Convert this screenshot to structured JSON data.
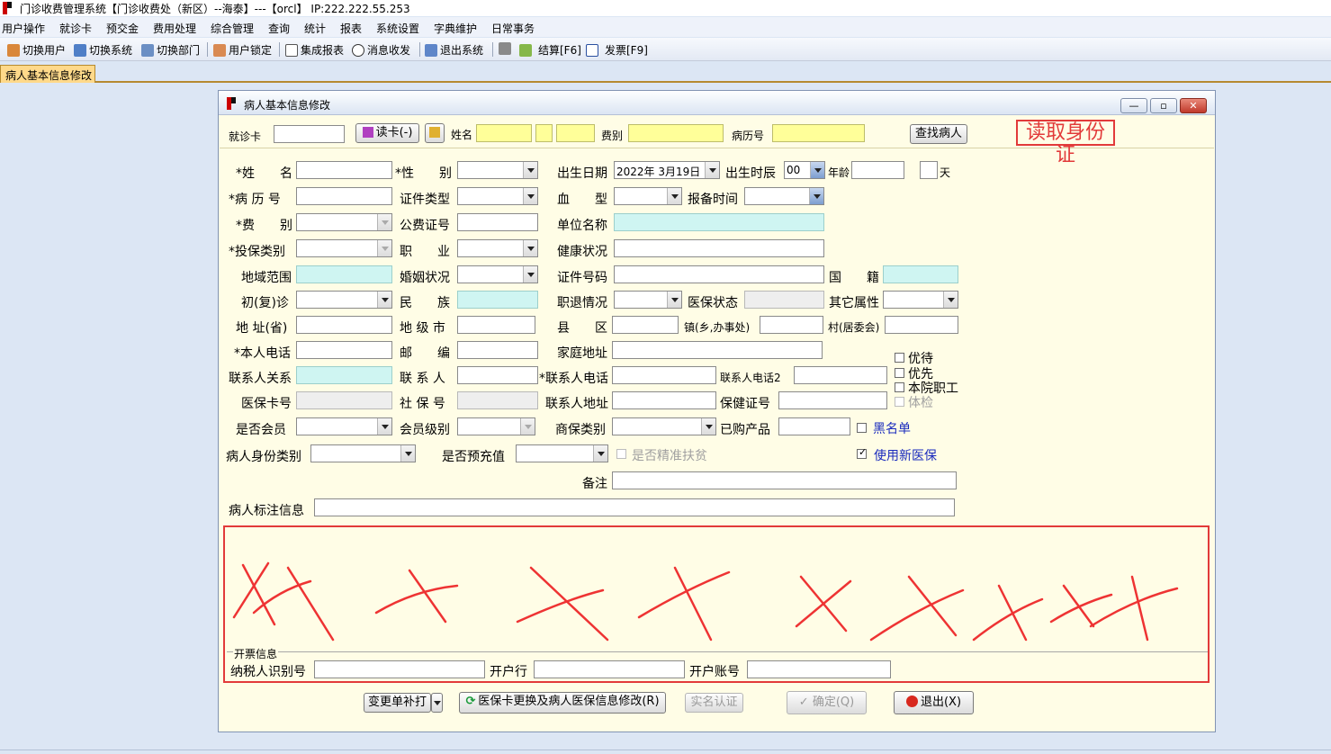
{
  "window_title": "门诊收费管理系统【门诊收费处（新区）--海泰】---【orcl】 IP:222.222.55.253",
  "menu": [
    "用户操作",
    "就诊卡",
    "预交金",
    "费用处理",
    "综合管理",
    "查询",
    "统计",
    "报表",
    "系统设置",
    "字典维护",
    "日常事务"
  ],
  "toolbar": {
    "switch_user": "切换用户",
    "switch_system": "切换系统",
    "switch_dept": "切换部门",
    "lock_user": "用户锁定",
    "integrated_report": "集成报表",
    "messages": "消息收发",
    "exit_system": "退出系统",
    "settle": "结算[F6]",
    "invoice": "发票[F9]"
  },
  "tab": {
    "label": "病人基本信息修改"
  },
  "dialog": {
    "title": "病人基本信息修改",
    "window_buttons": {
      "minimize": "—",
      "maximize": "▫",
      "close": "✕"
    },
    "search": {
      "card_label": "就诊卡",
      "read_card_button": "读卡(-)",
      "name_label": "姓名",
      "fee_label": "费别",
      "record_label": "病历号",
      "find_button": "查找病人",
      "annotation": "读取身份证"
    },
    "form": {
      "name": "*姓　　名",
      "gender": "*性　　别",
      "birth_date": "出生日期",
      "birth_date_value": "2022年 3月19日",
      "birth_hour": "出生时辰",
      "birth_hour_value": "00",
      "age": "年龄",
      "day": "天",
      "record_no": "*病 历 号",
      "id_type": "证件类型",
      "blood_type": "血　　型",
      "report_time": "报备时间",
      "fee_type": "*费　　别",
      "public_fee_no": "公费证号",
      "employer": "单位名称",
      "insurance_type": "*投保类别",
      "occupation": "职　　业",
      "health": "健康状况",
      "region": "地域范围",
      "marital": "婚姻状况",
      "id_no": "证件号码",
      "nationality": "国　　籍",
      "first_visit": "初(复)诊",
      "ethnicity": "民　　族",
      "retirement": "职退情况",
      "insurance_status": "医保状态",
      "other_attr": "其它属性",
      "addr_province": "地 址(省)",
      "addr_city": "地 级 市",
      "addr_county": "县　　区",
      "addr_town": "镇(乡,办事处)",
      "addr_village": "村(居委会)",
      "phone": "*本人电话",
      "postcode": "邮　　编",
      "home_addr": "家庭地址",
      "contact_rel": "联系人关系",
      "contact": "联 系 人",
      "contact_phone": "*联系人电话",
      "contact_phone2": "联系人电话2",
      "insurance_card": "医保卡号",
      "social_no": "社 保 号",
      "contact_addr": "联系人地址",
      "health_card": "保健证号",
      "member": "是否会员",
      "member_level": "会员级别",
      "commercial": "商保类别",
      "purchased": "已购产品",
      "blacklist": "黑名单",
      "identity_cat": "病人身份类别",
      "prepaid": "是否预充值",
      "poverty": "是否精准扶贫",
      "new_insurance": "使用新医保",
      "remark": "备注",
      "tag_info": "病人标注信息",
      "check_vip": "优待",
      "check_priority": "优先",
      "check_staff": "本院职工",
      "check_exam": "体检"
    },
    "invoice": {
      "legend": "开票信息",
      "taxpayer_id": "纳税人识别号",
      "bank": "开户行",
      "account": "开户账号"
    },
    "buttons": {
      "reprint": "变更单补打",
      "replace_card": "医保卡更换及病人医保信息修改(R)",
      "verify": "实名认证",
      "confirm": "确定(Q)",
      "exit": "退出(X)"
    }
  }
}
